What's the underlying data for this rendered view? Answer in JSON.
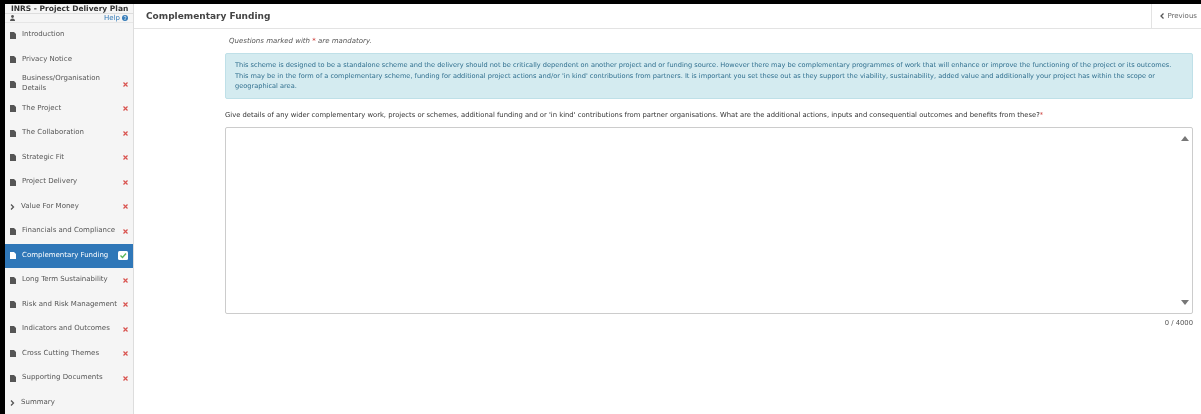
{
  "sidebar": {
    "title": "INRS - Project Delivery Plan",
    "help": "Help",
    "items": [
      {
        "label": "Introduction",
        "kind": "page",
        "selected": false
      },
      {
        "label": "Privacy Notice",
        "kind": "page",
        "selected": false
      },
      {
        "label": "Business/Organisation Details",
        "kind": "page",
        "complete": false,
        "selected": false
      },
      {
        "label": "The Project",
        "kind": "page",
        "complete": false,
        "selected": false
      },
      {
        "label": "The Collaboration",
        "kind": "page",
        "complete": false,
        "selected": false
      },
      {
        "label": "Strategic Fit",
        "kind": "page",
        "complete": false,
        "selected": false
      },
      {
        "label": "Project Delivery",
        "kind": "page",
        "complete": false,
        "selected": false
      },
      {
        "label": "Value For Money",
        "kind": "group",
        "complete": false,
        "selected": false
      },
      {
        "label": "Financials and Compliance",
        "kind": "page",
        "complete": false,
        "selected": false
      },
      {
        "label": "Complementary Funding",
        "kind": "page",
        "complete": true,
        "selected": true
      },
      {
        "label": "Long Term Sustainability",
        "kind": "page",
        "complete": false,
        "selected": false
      },
      {
        "label": "Risk and Risk Management",
        "kind": "page",
        "complete": false,
        "selected": false
      },
      {
        "label": "Indicators and Outcomes",
        "kind": "page",
        "complete": false,
        "selected": false
      },
      {
        "label": "Cross Cutting Themes",
        "kind": "page",
        "complete": false,
        "selected": false
      },
      {
        "label": "Supporting Documents",
        "kind": "page",
        "complete": false,
        "selected": false
      },
      {
        "label": "Summary",
        "kind": "group",
        "selected": false
      }
    ]
  },
  "header": {
    "title": "Complementary Funding",
    "previous": "Previous"
  },
  "mandatory_note": {
    "before": "Questions marked with ",
    "marker": "*",
    "after": " are mandatory."
  },
  "info": "This scheme is designed to be a standalone scheme and the delivery should not be critically dependent on another project and or funding source. However there may be complementary programmes of work that will enhance or improve the functioning of the project or its outcomes. This may be in the form of a complementary scheme, funding for additional project actions and/or 'in kind' contributions from partners. It is important you set these out as they support the viability, sustainability, added value and additionally your project has within the scope or geographical area.",
  "question": {
    "label": "Give details of any wider complementary work, projects or schemes, additional funding and or 'in kind' contributions from partner organisations. What are the additional actions, inputs and consequential outcomes and benefits from these?",
    "required": true,
    "counter": "0 / 4000"
  }
}
